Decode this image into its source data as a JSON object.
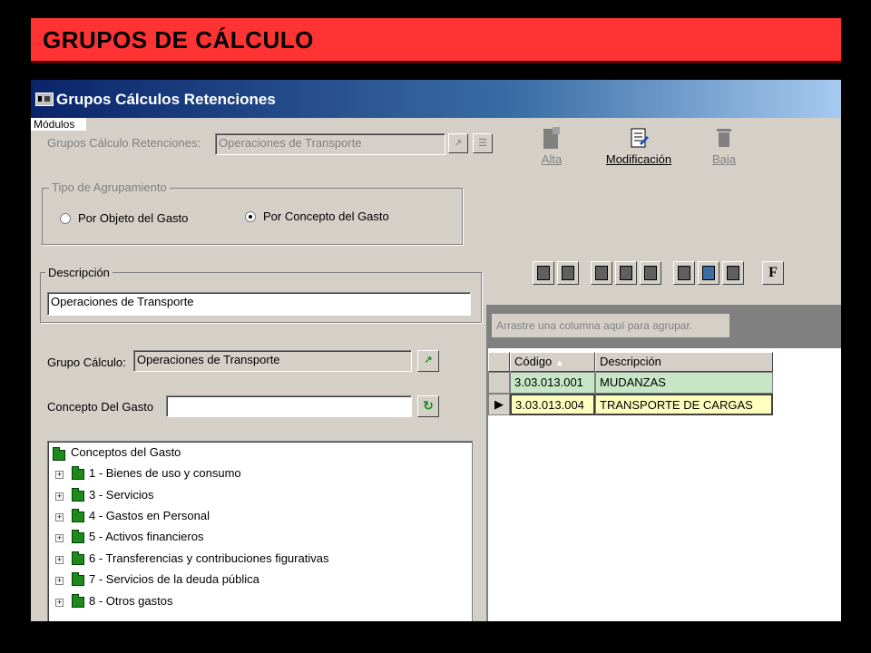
{
  "slide": {
    "title": "GRUPOS DE CÁLCULO"
  },
  "window": {
    "title": "Grupos Cálculos Retenciones",
    "modulos_label": "Módulos"
  },
  "header_form": {
    "grupos_label": "Grupos Cálculo Retenciones:",
    "grupos_value": "Operaciones de Transporte"
  },
  "toolbar": {
    "alta": "Alta",
    "modificacion": "Modificación",
    "baja": "Baja"
  },
  "tipo_agrupamiento": {
    "caption": "Tipo de Agrupamiento",
    "option_objeto": "Por Objeto del Gasto",
    "option_concepto": "Por Concepto del Gasto",
    "selected": "Por Concepto del Gasto"
  },
  "descripcion": {
    "caption": "Descripción",
    "value": "Operaciones de Transporte"
  },
  "grupo_calculo": {
    "label": "Grupo Cálculo:",
    "value": "Operaciones de Transporte"
  },
  "concepto_gasto": {
    "label": "Concepto Del Gasto",
    "value": ""
  },
  "tree": {
    "root": "Conceptos del Gasto",
    "items": [
      "1 - Bienes de uso y consumo",
      "3 - Servicios",
      "4 - Gastos en Personal",
      "5 - Activos financieros",
      "6 - Transferencias y contribuciones figurativas",
      "7 - Servicios de la deuda pública",
      "8 - Otros gastos"
    ]
  },
  "grid_toolbar": {
    "f_button": "F"
  },
  "grid": {
    "group_hint": "Arrastre una columna aquí para agrupar.",
    "columns": [
      "Código",
      "Descripción"
    ],
    "rows": [
      {
        "codigo": "3.03.013.001",
        "descripcion": "MUDANZAS"
      },
      {
        "codigo": "3.03.013.004",
        "descripcion": "TRANSPORTE DE CARGAS"
      }
    ],
    "row_colors": {
      "row1": "#c6e6c6",
      "row2": "#ffffc0"
    }
  },
  "colors": {
    "banner": "#ff3333",
    "window_bg": "#d4d0c8",
    "titlebar_start": "#0a246a",
    "folder": "#1e8a1e"
  }
}
